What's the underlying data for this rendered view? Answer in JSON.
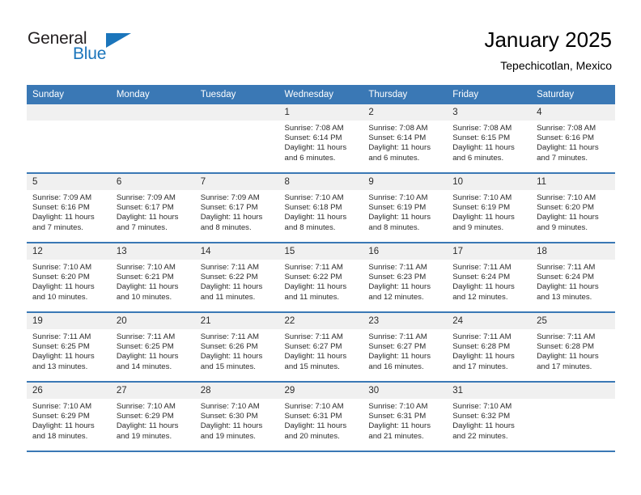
{
  "brand": {
    "name_top": "General",
    "name_bottom": "Blue",
    "accent_color": "#1b75bb",
    "text_color": "#231f20"
  },
  "header": {
    "title": "January 2025",
    "subtitle": "Tepechicotlan, Mexico",
    "header_bg": "#3a78b5",
    "header_text": "#ffffff",
    "daynum_bg": "#f0f0f0"
  },
  "weekdays": [
    "Sunday",
    "Monday",
    "Tuesday",
    "Wednesday",
    "Thursday",
    "Friday",
    "Saturday"
  ],
  "weeks": [
    [
      {
        "day": "",
        "sunrise": "",
        "sunset": "",
        "daylight_1": "",
        "daylight_2": ""
      },
      {
        "day": "",
        "sunrise": "",
        "sunset": "",
        "daylight_1": "",
        "daylight_2": ""
      },
      {
        "day": "",
        "sunrise": "",
        "sunset": "",
        "daylight_1": "",
        "daylight_2": ""
      },
      {
        "day": "1",
        "sunrise": "Sunrise: 7:08 AM",
        "sunset": "Sunset: 6:14 PM",
        "daylight_1": "Daylight: 11 hours",
        "daylight_2": "and 6 minutes."
      },
      {
        "day": "2",
        "sunrise": "Sunrise: 7:08 AM",
        "sunset": "Sunset: 6:14 PM",
        "daylight_1": "Daylight: 11 hours",
        "daylight_2": "and 6 minutes."
      },
      {
        "day": "3",
        "sunrise": "Sunrise: 7:08 AM",
        "sunset": "Sunset: 6:15 PM",
        "daylight_1": "Daylight: 11 hours",
        "daylight_2": "and 6 minutes."
      },
      {
        "day": "4",
        "sunrise": "Sunrise: 7:08 AM",
        "sunset": "Sunset: 6:16 PM",
        "daylight_1": "Daylight: 11 hours",
        "daylight_2": "and 7 minutes."
      }
    ],
    [
      {
        "day": "5",
        "sunrise": "Sunrise: 7:09 AM",
        "sunset": "Sunset: 6:16 PM",
        "daylight_1": "Daylight: 11 hours",
        "daylight_2": "and 7 minutes."
      },
      {
        "day": "6",
        "sunrise": "Sunrise: 7:09 AM",
        "sunset": "Sunset: 6:17 PM",
        "daylight_1": "Daylight: 11 hours",
        "daylight_2": "and 7 minutes."
      },
      {
        "day": "7",
        "sunrise": "Sunrise: 7:09 AM",
        "sunset": "Sunset: 6:17 PM",
        "daylight_1": "Daylight: 11 hours",
        "daylight_2": "and 8 minutes."
      },
      {
        "day": "8",
        "sunrise": "Sunrise: 7:10 AM",
        "sunset": "Sunset: 6:18 PM",
        "daylight_1": "Daylight: 11 hours",
        "daylight_2": "and 8 minutes."
      },
      {
        "day": "9",
        "sunrise": "Sunrise: 7:10 AM",
        "sunset": "Sunset: 6:19 PM",
        "daylight_1": "Daylight: 11 hours",
        "daylight_2": "and 8 minutes."
      },
      {
        "day": "10",
        "sunrise": "Sunrise: 7:10 AM",
        "sunset": "Sunset: 6:19 PM",
        "daylight_1": "Daylight: 11 hours",
        "daylight_2": "and 9 minutes."
      },
      {
        "day": "11",
        "sunrise": "Sunrise: 7:10 AM",
        "sunset": "Sunset: 6:20 PM",
        "daylight_1": "Daylight: 11 hours",
        "daylight_2": "and 9 minutes."
      }
    ],
    [
      {
        "day": "12",
        "sunrise": "Sunrise: 7:10 AM",
        "sunset": "Sunset: 6:20 PM",
        "daylight_1": "Daylight: 11 hours",
        "daylight_2": "and 10 minutes."
      },
      {
        "day": "13",
        "sunrise": "Sunrise: 7:10 AM",
        "sunset": "Sunset: 6:21 PM",
        "daylight_1": "Daylight: 11 hours",
        "daylight_2": "and 10 minutes."
      },
      {
        "day": "14",
        "sunrise": "Sunrise: 7:11 AM",
        "sunset": "Sunset: 6:22 PM",
        "daylight_1": "Daylight: 11 hours",
        "daylight_2": "and 11 minutes."
      },
      {
        "day": "15",
        "sunrise": "Sunrise: 7:11 AM",
        "sunset": "Sunset: 6:22 PM",
        "daylight_1": "Daylight: 11 hours",
        "daylight_2": "and 11 minutes."
      },
      {
        "day": "16",
        "sunrise": "Sunrise: 7:11 AM",
        "sunset": "Sunset: 6:23 PM",
        "daylight_1": "Daylight: 11 hours",
        "daylight_2": "and 12 minutes."
      },
      {
        "day": "17",
        "sunrise": "Sunrise: 7:11 AM",
        "sunset": "Sunset: 6:24 PM",
        "daylight_1": "Daylight: 11 hours",
        "daylight_2": "and 12 minutes."
      },
      {
        "day": "18",
        "sunrise": "Sunrise: 7:11 AM",
        "sunset": "Sunset: 6:24 PM",
        "daylight_1": "Daylight: 11 hours",
        "daylight_2": "and 13 minutes."
      }
    ],
    [
      {
        "day": "19",
        "sunrise": "Sunrise: 7:11 AM",
        "sunset": "Sunset: 6:25 PM",
        "daylight_1": "Daylight: 11 hours",
        "daylight_2": "and 13 minutes."
      },
      {
        "day": "20",
        "sunrise": "Sunrise: 7:11 AM",
        "sunset": "Sunset: 6:25 PM",
        "daylight_1": "Daylight: 11 hours",
        "daylight_2": "and 14 minutes."
      },
      {
        "day": "21",
        "sunrise": "Sunrise: 7:11 AM",
        "sunset": "Sunset: 6:26 PM",
        "daylight_1": "Daylight: 11 hours",
        "daylight_2": "and 15 minutes."
      },
      {
        "day": "22",
        "sunrise": "Sunrise: 7:11 AM",
        "sunset": "Sunset: 6:27 PM",
        "daylight_1": "Daylight: 11 hours",
        "daylight_2": "and 15 minutes."
      },
      {
        "day": "23",
        "sunrise": "Sunrise: 7:11 AM",
        "sunset": "Sunset: 6:27 PM",
        "daylight_1": "Daylight: 11 hours",
        "daylight_2": "and 16 minutes."
      },
      {
        "day": "24",
        "sunrise": "Sunrise: 7:11 AM",
        "sunset": "Sunset: 6:28 PM",
        "daylight_1": "Daylight: 11 hours",
        "daylight_2": "and 17 minutes."
      },
      {
        "day": "25",
        "sunrise": "Sunrise: 7:11 AM",
        "sunset": "Sunset: 6:28 PM",
        "daylight_1": "Daylight: 11 hours",
        "daylight_2": "and 17 minutes."
      }
    ],
    [
      {
        "day": "26",
        "sunrise": "Sunrise: 7:10 AM",
        "sunset": "Sunset: 6:29 PM",
        "daylight_1": "Daylight: 11 hours",
        "daylight_2": "and 18 minutes."
      },
      {
        "day": "27",
        "sunrise": "Sunrise: 7:10 AM",
        "sunset": "Sunset: 6:29 PM",
        "daylight_1": "Daylight: 11 hours",
        "daylight_2": "and 19 minutes."
      },
      {
        "day": "28",
        "sunrise": "Sunrise: 7:10 AM",
        "sunset": "Sunset: 6:30 PM",
        "daylight_1": "Daylight: 11 hours",
        "daylight_2": "and 19 minutes."
      },
      {
        "day": "29",
        "sunrise": "Sunrise: 7:10 AM",
        "sunset": "Sunset: 6:31 PM",
        "daylight_1": "Daylight: 11 hours",
        "daylight_2": "and 20 minutes."
      },
      {
        "day": "30",
        "sunrise": "Sunrise: 7:10 AM",
        "sunset": "Sunset: 6:31 PM",
        "daylight_1": "Daylight: 11 hours",
        "daylight_2": "and 21 minutes."
      },
      {
        "day": "31",
        "sunrise": "Sunrise: 7:10 AM",
        "sunset": "Sunset: 6:32 PM",
        "daylight_1": "Daylight: 11 hours",
        "daylight_2": "and 22 minutes."
      },
      {
        "day": "",
        "sunrise": "",
        "sunset": "",
        "daylight_1": "",
        "daylight_2": ""
      }
    ]
  ]
}
